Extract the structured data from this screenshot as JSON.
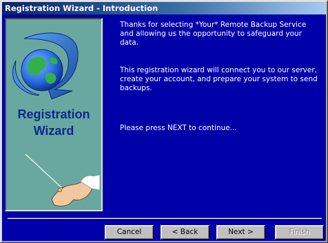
{
  "window": {
    "title": "Registration Wizard - Introduction"
  },
  "side_image": {
    "logo_line1": "Registration",
    "logo_line2": "Wizard",
    "icons": [
      "globe-arrow-icon",
      "pointing-hand-icon"
    ]
  },
  "content": {
    "paragraph1": "Thanks for selecting *Your* Remote Backup Service and allowing us the opportunity to safeguard your data.",
    "paragraph2": "This registration wizard will connect you to our server, create your account, and prepare your system to send backups.",
    "paragraph3": "Please press NEXT to continue..."
  },
  "buttons": {
    "cancel": "Cancel",
    "back": "< Back",
    "next": "Next >",
    "finish": "Finish"
  },
  "colors": {
    "panel_background": "#0000a8",
    "image_background": "#68a8a0",
    "title_gradient_start": "#0a246a",
    "logo_text": "#0a2a8a"
  }
}
